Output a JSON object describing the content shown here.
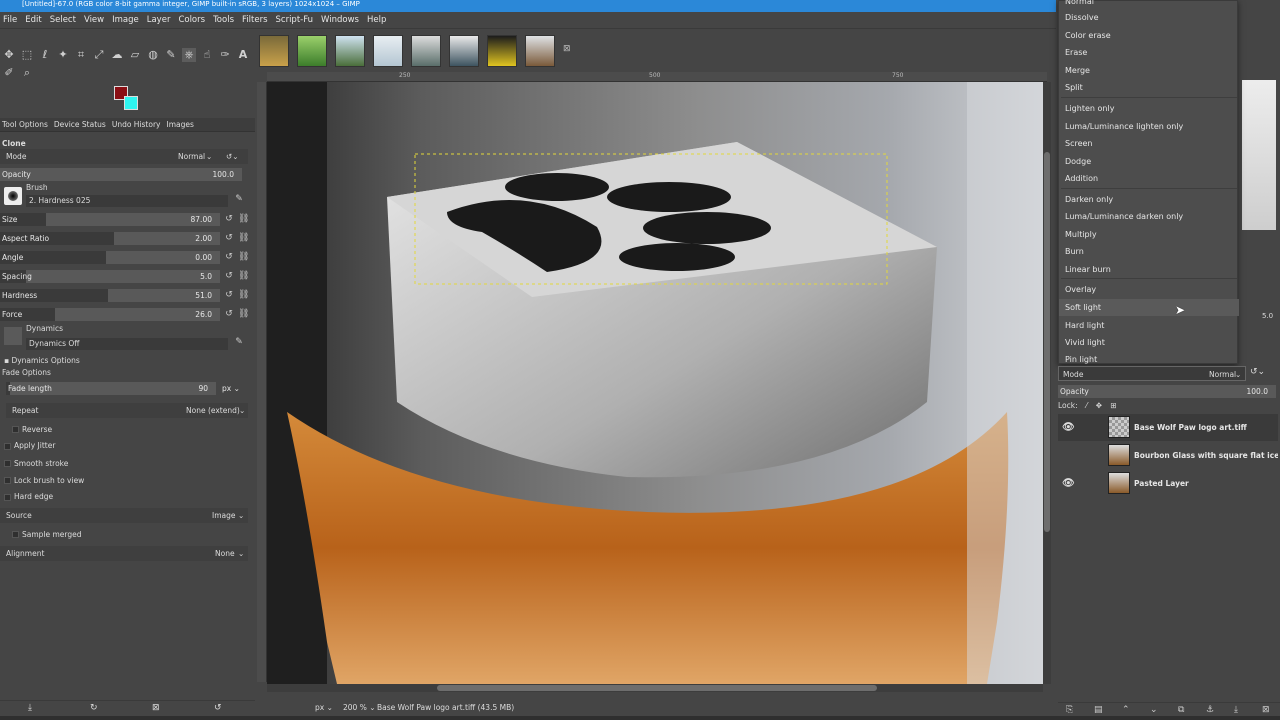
{
  "window": {
    "title": "[Untitled]-67.0 (RGB color 8-bit gamma integer, GIMP built-in sRGB, 3 layers) 1024x1024 – GIMP"
  },
  "menu": [
    "File",
    "Edit",
    "Select",
    "View",
    "Image",
    "Layer",
    "Colors",
    "Tools",
    "Filters",
    "Script-Fu",
    "Windows",
    "Help"
  ],
  "colors": {
    "foreground": "#8a0f14",
    "background": "#2ff5f0"
  },
  "left_dock": {
    "tabs": [
      "Tool Options",
      "Device Status",
      "Undo History",
      "Images"
    ],
    "tool_name": "Clone",
    "mode_label": "Mode",
    "mode_value": "Normal",
    "opacity_label": "Opacity",
    "opacity_value": "100.0",
    "brush_label": "Brush",
    "brush_value": "2. Hardness 025",
    "sliders": [
      {
        "label": "Size",
        "value": "87.00",
        "fraction": 0.21
      },
      {
        "label": "Aspect Ratio",
        "value": "2.00",
        "fraction": 0.52
      },
      {
        "label": "Angle",
        "value": "0.00",
        "fraction": 0.48
      },
      {
        "label": "Spacing",
        "value": "5.0",
        "fraction": 0.12
      },
      {
        "label": "Hardness",
        "value": "51.0",
        "fraction": 0.49
      },
      {
        "label": "Force",
        "value": "26.0",
        "fraction": 0.25
      }
    ],
    "dynamics_label": "Dynamics",
    "dynamics_value": "Dynamics Off",
    "dynamics_options": "Dynamics Options",
    "fade_options": "Fade Options",
    "fade_length_label": "Fade length",
    "fade_length_value": "90",
    "fade_unit": "px",
    "repeat_label": "Repeat",
    "repeat_value": "None (extend)",
    "reverse": "Reverse",
    "apply_jitter": "Apply Jitter",
    "smooth_stroke": "Smooth stroke",
    "lock_brush": "Lock brush to view",
    "hard_edge": "Hard edge",
    "source_label": "Source",
    "source_value": "Image",
    "sample_merged": "Sample merged",
    "alignment_label": "Alignment",
    "alignment_value": "None"
  },
  "ruler": {
    "ticks": [
      "250",
      "500",
      "750"
    ]
  },
  "status": {
    "unit": "px",
    "zoom": "200 %",
    "info": "Base Wolf Paw logo art.tiff (43.5 MB)"
  },
  "blend_menu": {
    "items": [
      "Normal",
      "Dissolve",
      "Color erase",
      "Erase",
      "Merge",
      "Split",
      "Lighten only",
      "Luma/Luminance lighten only",
      "Screen",
      "Dodge",
      "Addition",
      "Darken only",
      "Luma/Luminance darken only",
      "Multiply",
      "Burn",
      "Linear burn",
      "Overlay",
      "Soft light",
      "Hard light",
      "Vivid light",
      "Pin light"
    ],
    "highlighted": "Soft light"
  },
  "layers_panel": {
    "mode_label": "Mode",
    "mode_value": "Normal",
    "opacity_label": "Opacity",
    "opacity_value": "100.0",
    "lock_label": "Lock:",
    "brush_spacing_value": "5.0",
    "layers": [
      {
        "name": "Base Wolf Paw logo art.tiff",
        "visible": true
      },
      {
        "name": "Bourbon Glass with square flat ice cub",
        "visible": false
      },
      {
        "name": "Pasted Layer",
        "visible": true
      }
    ]
  }
}
